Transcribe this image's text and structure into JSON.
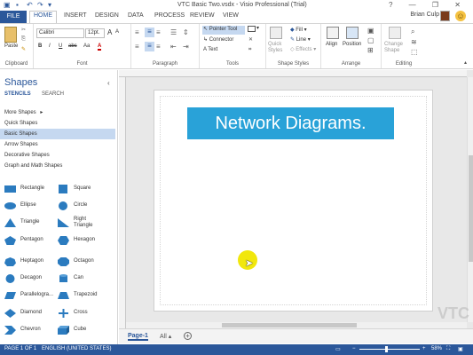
{
  "window": {
    "title": "VTC Basic Two.vsdx - Visio Professional (Trial)",
    "user": "Brian Culp",
    "minimize": "—",
    "restore": "❐",
    "close": "✕",
    "help": "?"
  },
  "tabs": [
    "FILE",
    "HOME",
    "INSERT",
    "DESIGN",
    "DATA",
    "PROCESS",
    "REVIEW",
    "VIEW"
  ],
  "ribbon": {
    "clipboard": {
      "label": "Clipboard",
      "paste": "Paste"
    },
    "font": {
      "label": "Font",
      "font_name": "Calibri",
      "font_size": "12pt.",
      "bold": "B",
      "italic": "I",
      "underline": "U",
      "strike": "abc",
      "size_up": "A",
      "size_down": "A",
      "aa": "Aa",
      "font_color": "A"
    },
    "paragraph": {
      "label": "Paragraph"
    },
    "tools": {
      "label": "Tools",
      "pointer": "Pointer Tool",
      "connector": "Connector",
      "text": "Text"
    },
    "shape_styles": {
      "label": "Shape Styles",
      "quick_styles": "Quick Styles",
      "fill": "Fill",
      "line": "Line",
      "effects": "Effects"
    },
    "arrange": {
      "label": "Arrange",
      "align": "Align",
      "position": "Position"
    },
    "editing": {
      "label": "Editing",
      "change_shape": "Change Shape"
    }
  },
  "shapes_panel": {
    "title": "Shapes",
    "stencils": "STENCILS",
    "search": "SEARCH",
    "categories": [
      "More Shapes",
      "Quick Shapes",
      "Basic Shapes",
      "Arrow Shapes",
      "Decorative Shapes",
      "Graph and Math Shapes"
    ],
    "selected_category": "Basic Shapes",
    "shapes": [
      [
        "Rectangle",
        "Square"
      ],
      [
        "Ellipse",
        "Circle"
      ],
      [
        "Triangle",
        "Right Triangle"
      ],
      [
        "Pentagon",
        "Hexagon"
      ],
      [
        "Heptagon",
        "Octagon"
      ],
      [
        "Decagon",
        "Can"
      ],
      [
        "Parallelogra...",
        "Trapezoid"
      ],
      [
        "Diamond",
        "Cross"
      ],
      [
        "Chevron",
        "Cube"
      ]
    ]
  },
  "canvas": {
    "banner_text": "Network Diagrams.",
    "watermark": "VTC"
  },
  "page_tabs": {
    "current": "Page-1",
    "all": "All"
  },
  "status": {
    "page": "PAGE 1 OF 1",
    "language": "ENGLISH (UNITED STATES)",
    "zoom": "58%"
  },
  "colors": {
    "accent": "#2b579a",
    "banner": "#29a2d8",
    "cursor_highlight": "#f0e600"
  }
}
